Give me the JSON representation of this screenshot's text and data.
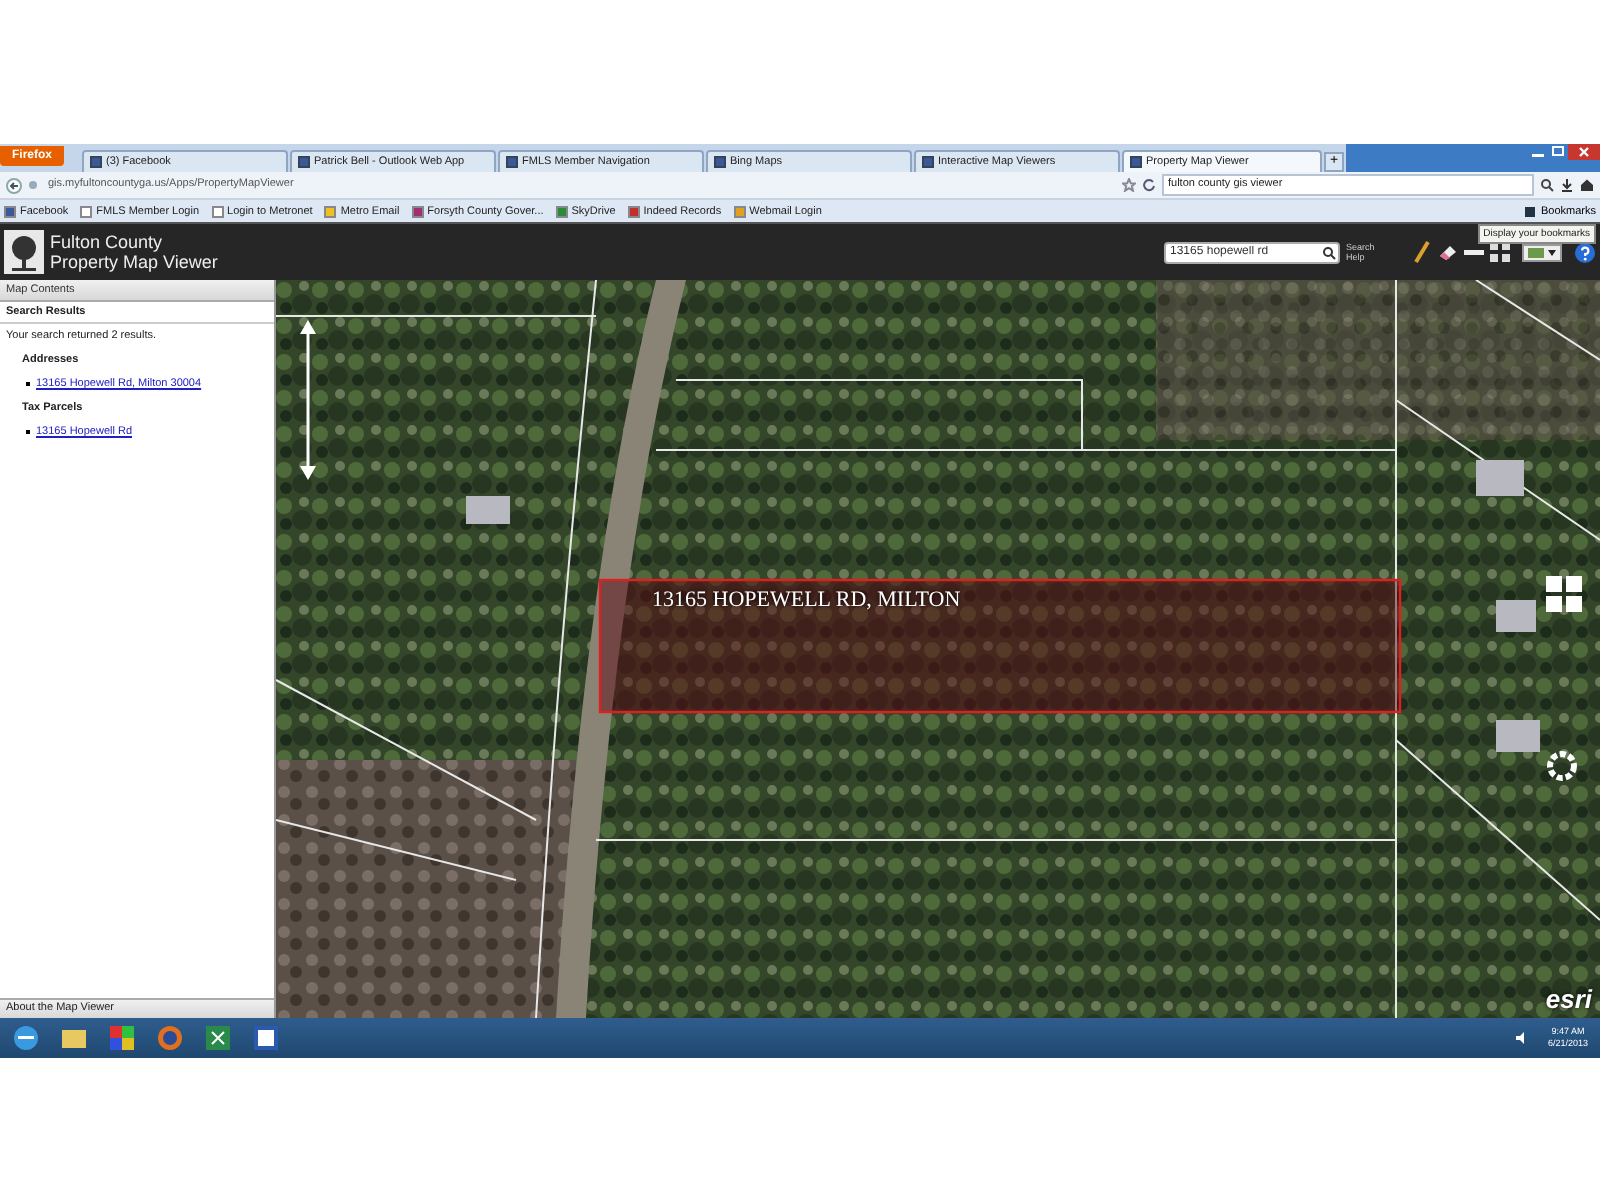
{
  "browser": {
    "menu_button": "Firefox",
    "tabs": [
      {
        "label": "(3) Facebook",
        "selected": false
      },
      {
        "label": "Patrick Bell - Outlook Web App",
        "selected": false
      },
      {
        "label": "FMLS Member Navigation",
        "selected": false
      },
      {
        "label": "Bing Maps",
        "selected": false
      },
      {
        "label": "Interactive Map Viewers",
        "selected": false
      },
      {
        "label": "Property Map Viewer",
        "selected": true
      }
    ],
    "new_tab": "+",
    "url": "gis.myfultoncountyga.us/Apps/PropertyMapViewer",
    "search": "fulton county gis viewer",
    "bookmarks": [
      "Facebook",
      "FMLS Member Login",
      "Login to Metronet",
      "Metro Email",
      "Forsyth County Gover...",
      "SkyDrive",
      "Indeed Records",
      "Webmail Login"
    ],
    "bookmarks_menu": "Bookmarks"
  },
  "app": {
    "title": "Fulton County",
    "subtitle": "Property Map Viewer",
    "search": {
      "value": "13165 hopewell rd"
    },
    "search_help": "Search Help",
    "tooltip": "Display your bookmarks"
  },
  "sidebar": {
    "header": "Map Contents",
    "section": "Search Results",
    "summary": "Your search returned 2 results.",
    "groups": [
      {
        "heading": "Addresses",
        "results": [
          "13165 Hopewell Rd, Milton 30004"
        ]
      },
      {
        "heading": "Tax Parcels",
        "results": [
          "13165 Hopewell Rd"
        ]
      }
    ],
    "footer": "About the Map Viewer"
  },
  "map": {
    "parcel_label": "13165 HOPEWELL RD, MILTON",
    "attribution": "esri"
  },
  "taskbar": {
    "time": "9:47 AM",
    "date": "6/21/2013"
  }
}
